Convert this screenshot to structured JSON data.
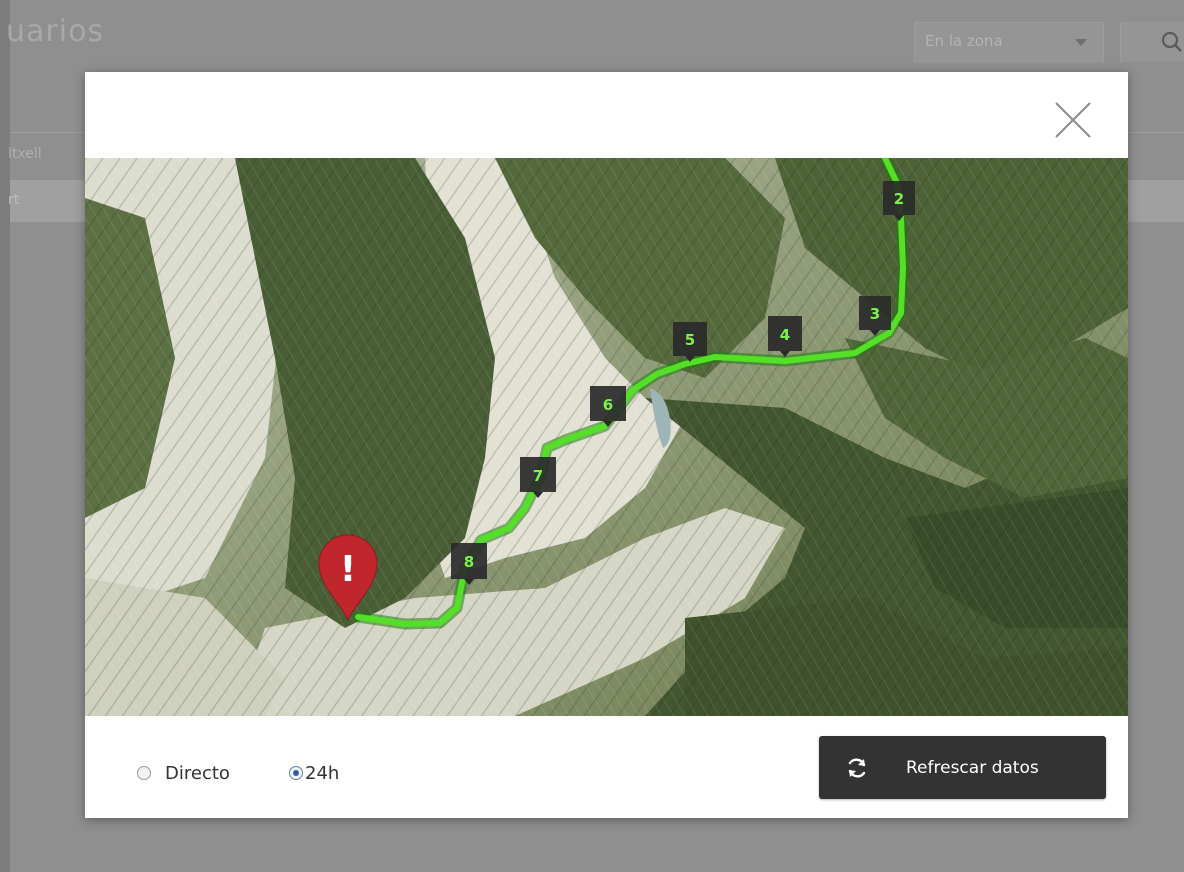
{
  "background": {
    "title": "uarios",
    "filter": {
      "selected": "En la zona"
    },
    "row1_text": "ltxell",
    "row2_text": "rt"
  },
  "modal": {
    "close_icon": "close-x-icon",
    "map": {
      "route_color": "#55e028",
      "markers": [
        {
          "label": "2"
        },
        {
          "label": "3"
        },
        {
          "label": "4"
        },
        {
          "label": "5"
        },
        {
          "label": "6"
        },
        {
          "label": "7"
        },
        {
          "label": "8"
        }
      ],
      "alert_marker": {
        "icon": "alert-pin-icon",
        "symbol": "!",
        "color": "#c0272d"
      }
    },
    "footer": {
      "options": [
        {
          "label": "Directo",
          "selected": false
        },
        {
          "label": "24h",
          "selected": true
        }
      ],
      "refresh_button": {
        "icon": "refresh-icon",
        "label": "Refrescar datos"
      }
    }
  }
}
